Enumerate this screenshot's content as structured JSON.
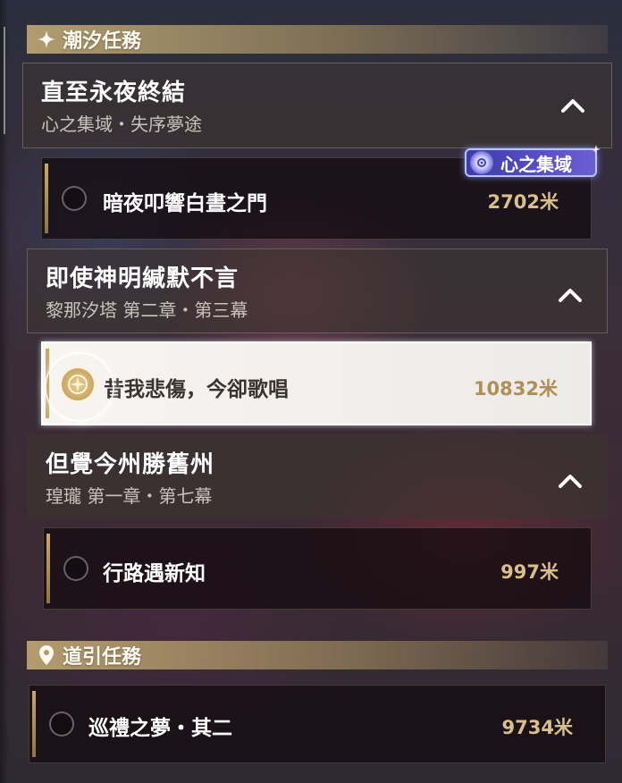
{
  "tide_section": {
    "title": "潮汐任務",
    "icon": "sparkle-icon"
  },
  "quests": [
    {
      "title": "直至永夜終結",
      "subtitle": "心之集域・失序夢途",
      "expanded": true,
      "objective": {
        "label": "暗夜叩響白晝之門",
        "distance": "2702米",
        "tracked": false
      },
      "region_tag": "心之集域"
    },
    {
      "title": "即使神明緘默不言",
      "subtitle": "黎那汐塔 第二章・第三幕",
      "expanded": true,
      "objective": {
        "label": "昔我悲傷，今卻歌唱",
        "distance": "10832米",
        "tracked": true
      }
    },
    {
      "title": "但覺今州勝舊州",
      "subtitle": "瑝瓏 第一章・第七幕",
      "expanded": true,
      "objective": {
        "label": "行路遇新知",
        "distance": "997米",
        "tracked": false
      }
    }
  ],
  "guide_section": {
    "title": "道引任務",
    "icon": "location-pin-icon",
    "objective": {
      "label": "巡禮之夢・其二",
      "distance": "9734米",
      "tracked": false
    }
  },
  "colors": {
    "accent_gold": "#c9a868",
    "distance_gold": "#d9c08a",
    "region_purple": "#5a4fc8"
  }
}
